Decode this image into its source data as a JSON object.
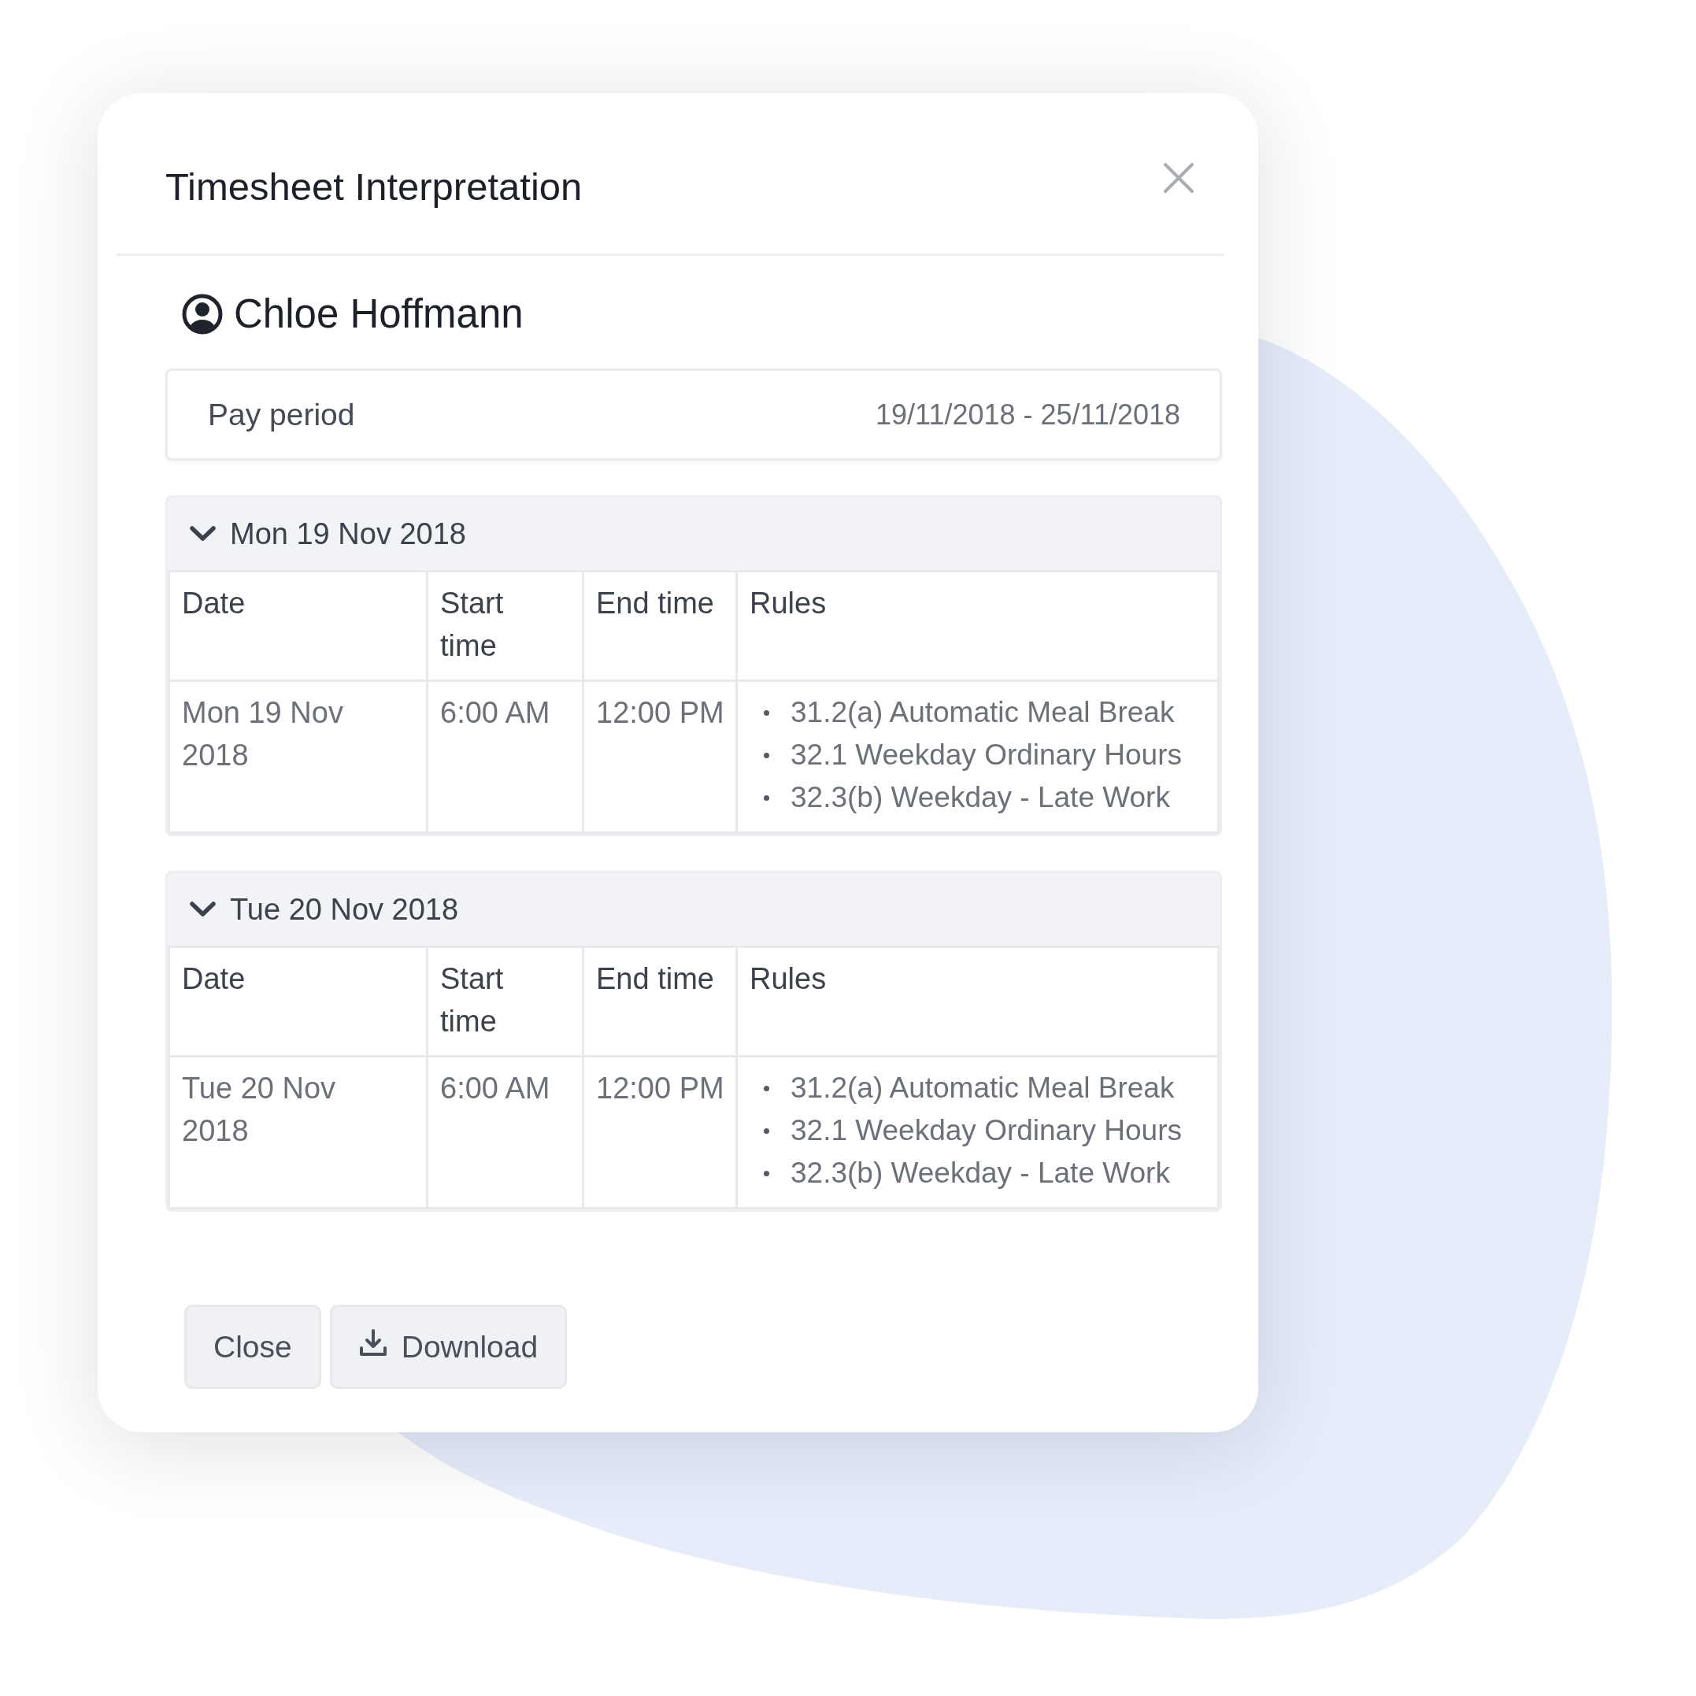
{
  "dialog": {
    "title": "Timesheet Interpretation"
  },
  "employee": {
    "name": "Chloe Hoffmann"
  },
  "pay_period": {
    "label": "Pay period",
    "value": "19/11/2018 - 25/11/2018"
  },
  "days": [
    {
      "heading": "Mon 19 Nov 2018",
      "expanded": true,
      "columns": [
        "Date",
        "Start time",
        "End time",
        "Rules"
      ],
      "rows": [
        {
          "date": "Mon 19 Nov 2018",
          "start_time": "6:00 AM",
          "end_time": "12:00 PM",
          "rules": [
            "31.2(a) Automatic Meal Break",
            "32.1 Weekday Ordinary Hours",
            "32.3(b) Weekday - Late Work"
          ]
        }
      ]
    },
    {
      "heading": "Tue 20 Nov 2018",
      "expanded": true,
      "columns": [
        "Date",
        "Start time",
        "End time",
        "Rules"
      ],
      "rows": [
        {
          "date": "Tue 20 Nov 2018",
          "start_time": "6:00 AM",
          "end_time": "12:00 PM",
          "rules": [
            "31.2(a) Automatic Meal Break",
            "32.1 Weekday Ordinary Hours",
            "32.3(b) Weekday - Late Work"
          ]
        }
      ]
    }
  ],
  "buttons": [
    {
      "label": "Close",
      "kind": "close"
    },
    {
      "label": "Download",
      "kind": "download"
    }
  ]
}
